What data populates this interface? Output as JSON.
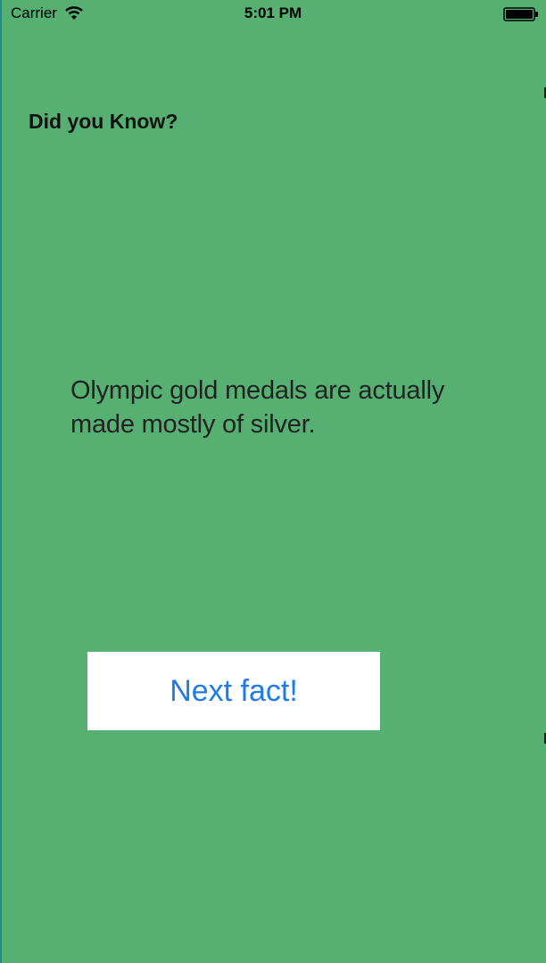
{
  "status_bar": {
    "carrier": "Carrier",
    "time": "5:01 PM",
    "icons": [
      "wifi-icon",
      "battery-icon"
    ]
  },
  "main": {
    "headline": "Did you Know?",
    "fact": "Olympic gold medals are actually made mostly of silver.",
    "next_button_label": "Next fact!"
  },
  "colors": {
    "background": "#56b071",
    "button_background": "#ffffff",
    "button_text": "#1e7ce6",
    "text": "#222222"
  }
}
